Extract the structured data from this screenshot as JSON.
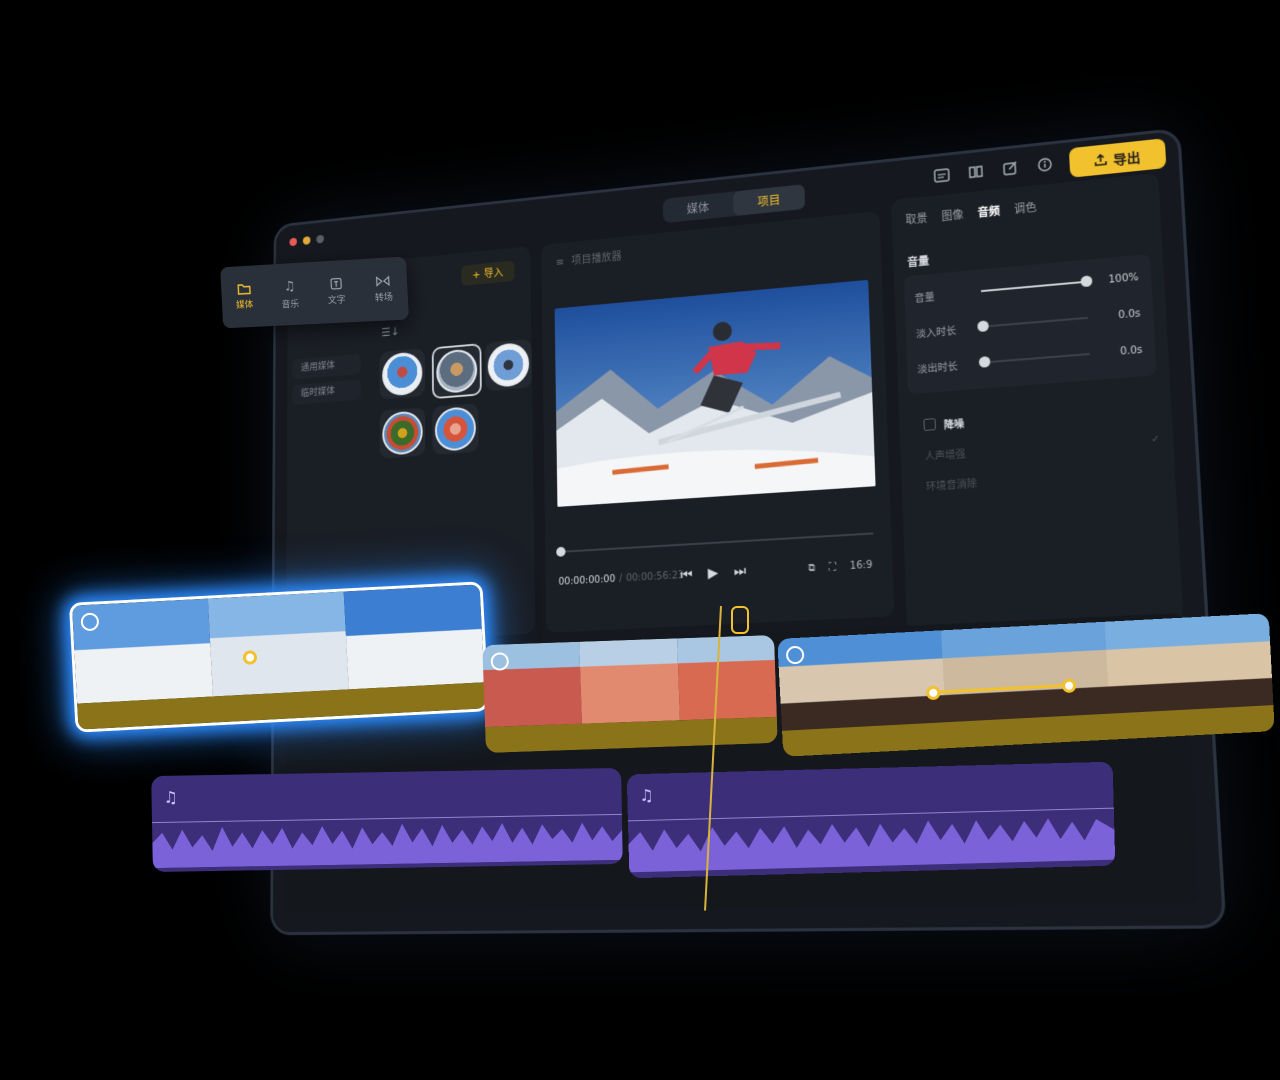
{
  "window": {
    "mode_tabs": [
      "媒体",
      "项目"
    ],
    "active_mode": "项目",
    "export_label": "导出",
    "top_icons": [
      "subtitles-icon",
      "book-icon",
      "edit-icon",
      "info-icon"
    ]
  },
  "tools": [
    {
      "label": "媒体",
      "icon": "folder-icon",
      "active": true
    },
    {
      "label": "音乐",
      "icon": "music-note-icon",
      "active": false
    },
    {
      "label": "文字",
      "icon": "text-icon",
      "active": false
    },
    {
      "label": "转场",
      "icon": "transition-icon",
      "active": false
    }
  ],
  "library": {
    "import_label": "导入",
    "subnav": [
      "通用媒体",
      "临时媒体"
    ],
    "thumbnails": [
      {
        "name": "ski-jump",
        "colors": [
          "#4c8ed6",
          "#e9eef3"
        ],
        "selected": false
      },
      {
        "name": "beach-walk",
        "colors": [
          "#c99b63",
          "#5d6d80"
        ],
        "selected": true
      },
      {
        "name": "snow-rider",
        "colors": [
          "#6f9ed6",
          "#edf1f4"
        ],
        "selected": false
      },
      {
        "name": "fruit-plate",
        "colors": [
          "#3a6b28",
          "#d1a21c"
        ],
        "selected": false
      },
      {
        "name": "friends-street",
        "colors": [
          "#d6543a",
          "#4c8ed6"
        ],
        "selected": false
      }
    ]
  },
  "preview": {
    "title": "项目播放器",
    "timecode_current": "00:00:00:00",
    "timecode_total": "00:00:56:23",
    "aspect": "16:9",
    "progress": 0
  },
  "properties": {
    "tabs": [
      "取景",
      "图像",
      "音频",
      "调色"
    ],
    "active_tab": "音频",
    "volume_section": "音量",
    "sliders": [
      {
        "label": "音量",
        "value": "100%",
        "level": 1.0
      },
      {
        "label": "淡入时长",
        "value": "0.0s",
        "level": 0.0
      },
      {
        "label": "淡出时长",
        "value": "0.0s",
        "level": 0.0
      }
    ],
    "denoise_label": "降噪",
    "denoise_options": [
      "人声增强",
      "环境音消除"
    ]
  },
  "timeline": {
    "clips": [
      {
        "name": "ski-clip",
        "frames": [
          "#7fb3e8",
          "#dfe8f0",
          "#6fa3db"
        ]
      },
      {
        "name": "street-clip",
        "frames": [
          "#b9c8a4",
          "#d86b62",
          "#e7a58f"
        ]
      },
      {
        "name": "horse-beach-clip",
        "frames": [
          "#5f98d8",
          "#c4b19a",
          "#d4b894"
        ]
      }
    ],
    "accent": "#f2c12e",
    "glow": "#2d8cff",
    "music_color": "#3d2e7a"
  }
}
